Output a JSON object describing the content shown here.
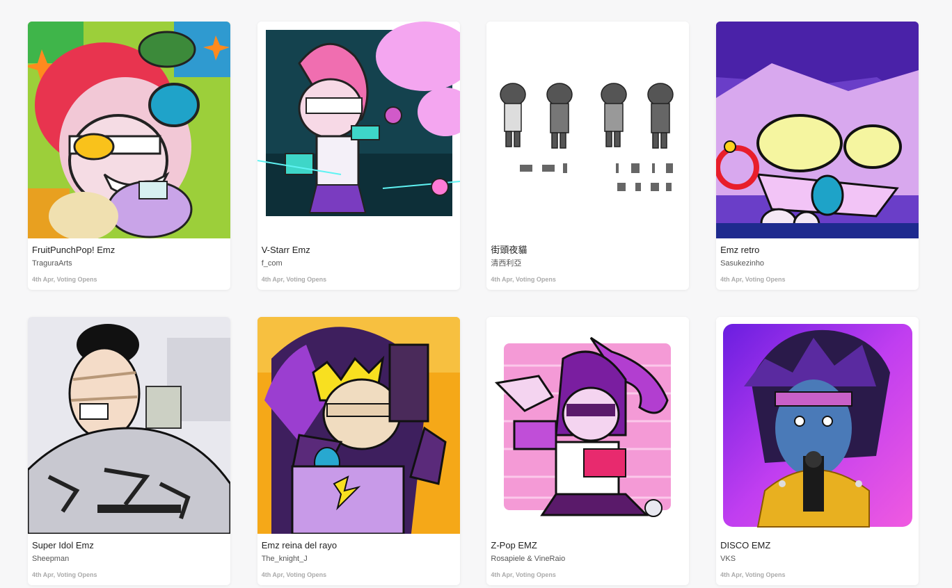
{
  "entries": [
    {
      "title": "FruitPunchPop! Emz",
      "author": "TraguraArts",
      "status": "4th Apr, Voting Opens"
    },
    {
      "title": "V-Starr Emz",
      "author": "f_com",
      "status": "4th Apr, Voting Opens"
    },
    {
      "title": "街頭夜貓",
      "author": "清西利亞",
      "status": "4th Apr, Voting Opens"
    },
    {
      "title": "Emz retro",
      "author": "Sasukezinho",
      "status": "4th Apr, Voting Opens"
    },
    {
      "title": "Super Idol Emz",
      "author": "Sheepman",
      "status": "4th Apr, Voting Opens"
    },
    {
      "title": "Emz reina del rayo",
      "author": "The_knight_J",
      "status": "4th Apr, Voting Opens"
    },
    {
      "title": "Z-Pop EMZ",
      "author": "Rosapiele & VineRaio",
      "status": "4th Apr, Voting Opens"
    },
    {
      "title": "DISCO EMZ",
      "author": "VKS",
      "status": "4th Apr, Voting Opens"
    }
  ]
}
